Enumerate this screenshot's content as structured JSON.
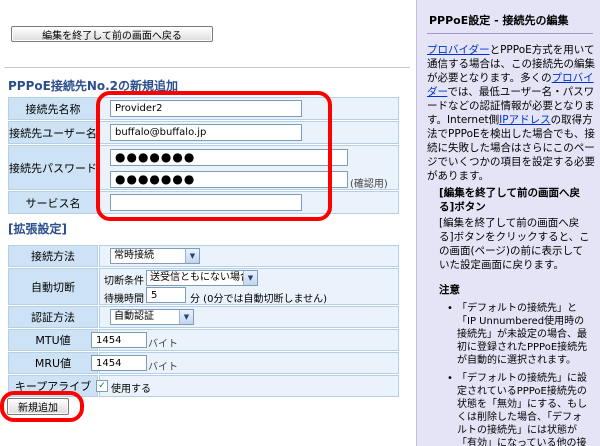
{
  "main": {
    "back_button": "編集を終了して前の画面へ戻る",
    "section_new": "PPPoE接続先No.2の新規追加",
    "section_ext": "[拡張設定]",
    "add_button": "新規追加"
  },
  "form": {
    "name_label": "接続先名称",
    "name_value": "Provider2",
    "user_label": "接続先ユーザー名",
    "user_value": "buffalo@buffalo.jp",
    "pw_label": "接続先パスワード",
    "pw_value": "●●●●●●●",
    "pw_confirm_value": "●●●●●●●",
    "pw_confirm_note": "(確認用)",
    "service_label": "サービス名",
    "service_value": ""
  },
  "ext": {
    "method_label": "接続方法",
    "method_value": "常時接続",
    "disconnect_label": "自動切断",
    "cond_label": "切断条件",
    "cond_value": "送受信ともにない場合",
    "wait_label": "待機時間",
    "wait_value": "5",
    "wait_note": "分 (0分では自動切断しません)",
    "auth_label": "認証方法",
    "auth_value": "自動認証",
    "mtu_label": "MTU値",
    "mtu_value": "1454",
    "mru_label": "MRU値",
    "mru_value": "1454",
    "byte_unit": "バイト",
    "keepalive_label": "キープアライブ",
    "keepalive_check": "使用する"
  },
  "help": {
    "title": "PPPoE設定 - 接続先の編集",
    "link_provider": "プロバイダー",
    "p1a": "とPPPoE方式を用いて通信する場合は、この接続先の編集が必要となります。多くの",
    "link_provider2": "プロバイダー",
    "p1b": "では、最低ユーザー名・パスワードなどの認証情報が必要となります。Internet側",
    "link_ip": "IPアドレス",
    "p1c": "の取得方法でPPPoEを検出した場合でも、接続に失敗した場合はさらにこのページでいくつかの項目を設定する必要があります。",
    "h2": "[編集を終了して前の画面へ戻る]ボタン",
    "p2": "[編集を終了して前の画面へ戻る]ボタンをクリックすると、この画面(ページ)の前に表示していた設定画面に戻ります。",
    "h3": "注意",
    "b1": "「デフォルトの接続先」と「IP Unnumbered使用時の接続先」が未設定の場合、最初に登録されたPPPoE接続先が自動的に選択されます。",
    "b2": "「デフォルトの接続先」に設定されているPPPoE接続先の状態を「無効」にする、もしくは削除した場合、「デフォルトの接続先」には状態が「有効」になっている他の接続先設定が自動的に選"
  },
  "colors": {
    "label_bg": "#cde3f5",
    "value_bg": "#eaf3fb",
    "section_text": "#2b4f8c",
    "help_bg": "#e4e4f6",
    "highlight": "#ff0000",
    "link": "#0033cc"
  }
}
